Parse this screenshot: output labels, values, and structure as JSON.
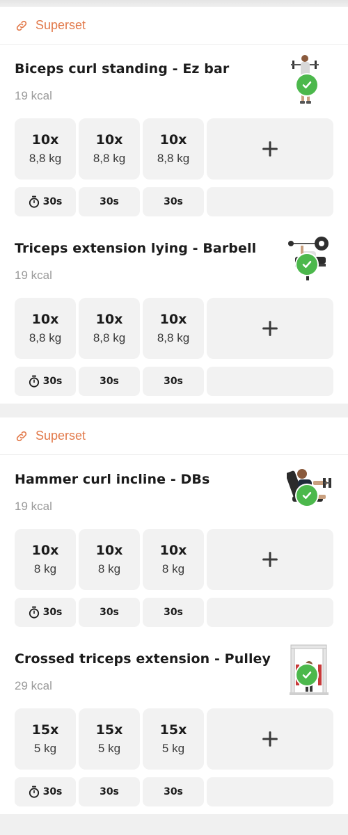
{
  "accent": "#e2794a",
  "check_color": "#4cb84c",
  "groups": [
    {
      "superset_label": "Superset",
      "exercises": [
        {
          "title": "Biceps curl standing - Ez bar",
          "kcal": "19 kcal",
          "thumb_icon": "barbell-curl-figure",
          "sets": [
            {
              "reps": "10x",
              "weight": "8,8 kg"
            },
            {
              "reps": "10x",
              "weight": "8,8 kg"
            },
            {
              "reps": "10x",
              "weight": "8,8 kg"
            }
          ],
          "rest": [
            "30s",
            "30s",
            "30s"
          ]
        },
        {
          "title": "Triceps extension lying - Barbell",
          "kcal": "19 kcal",
          "thumb_icon": "lying-barbell-figure",
          "sets": [
            {
              "reps": "10x",
              "weight": "8,8 kg"
            },
            {
              "reps": "10x",
              "weight": "8,8 kg"
            },
            {
              "reps": "10x",
              "weight": "8,8 kg"
            }
          ],
          "rest": [
            "30s",
            "30s",
            "30s"
          ]
        }
      ]
    },
    {
      "superset_label": "Superset",
      "exercises": [
        {
          "title": "Hammer curl incline - DBs",
          "kcal": "19 kcal",
          "thumb_icon": "incline-dumbbell-figure",
          "sets": [
            {
              "reps": "10x",
              "weight": "8 kg"
            },
            {
              "reps": "10x",
              "weight": "8 kg"
            },
            {
              "reps": "10x",
              "weight": "8 kg"
            }
          ],
          "rest": [
            "30s",
            "30s",
            "30s"
          ]
        },
        {
          "title": "Crossed triceps extension - Pulley",
          "kcal": "29 kcal",
          "thumb_icon": "pulley-machine-figure",
          "sets": [
            {
              "reps": "15x",
              "weight": "5 kg"
            },
            {
              "reps": "15x",
              "weight": "5 kg"
            },
            {
              "reps": "15x",
              "weight": "5 kg"
            }
          ],
          "rest": [
            "30s",
            "30s",
            "30s"
          ]
        }
      ]
    }
  ]
}
